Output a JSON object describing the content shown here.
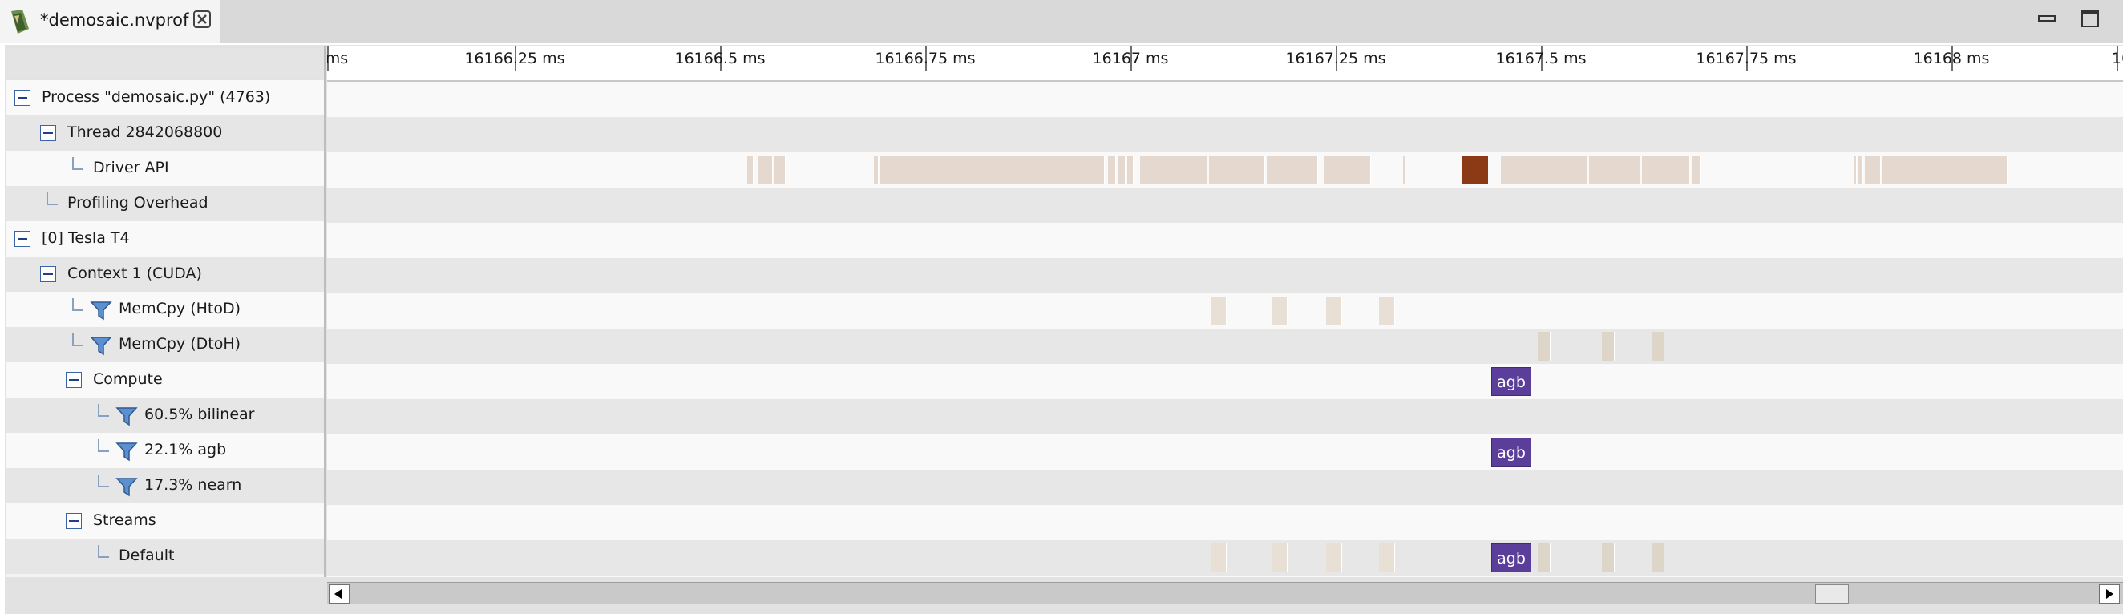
{
  "tab": {
    "title": "*demosaic.nvprof"
  },
  "timeline": {
    "ticks": [
      "ms",
      "16166.25 ms",
      "16166.5 ms",
      "16166.75 ms",
      "16167 ms",
      "16167.25 ms",
      "16167.5 ms",
      "16167.75 ms",
      "16168 ms",
      "16"
    ]
  },
  "tree": [
    {
      "label": "Process \"demosaic.py\" (4763)",
      "kind": "minus"
    },
    {
      "label": "Thread 2842068800",
      "kind": "minus"
    },
    {
      "label": "Driver API",
      "kind": "leaf"
    },
    {
      "label": "Profiling Overhead",
      "kind": "leaf"
    },
    {
      "label": "[0] Tesla T4",
      "kind": "minus"
    },
    {
      "label": "Context 1 (CUDA)",
      "kind": "minus"
    },
    {
      "label": "MemCpy (HtoD)",
      "kind": "filter"
    },
    {
      "label": "MemCpy (DtoH)",
      "kind": "filter"
    },
    {
      "label": "Compute",
      "kind": "minus"
    },
    {
      "label": "60.5% bilinear",
      "kind": "filter"
    },
    {
      "label": "22.1% agb",
      "kind": "filter"
    },
    {
      "label": "17.3% nearn",
      "kind": "filter"
    },
    {
      "label": "Streams",
      "kind": "minus"
    },
    {
      "label": "Default",
      "kind": "leaf"
    }
  ],
  "kernels": {
    "compute_label": "agb",
    "agb_label": "agb",
    "default_label": "agb"
  },
  "colors": {
    "kernel": "#5a3e9a",
    "api": "#e4d8cf",
    "api_selected": "#8c3a16"
  }
}
